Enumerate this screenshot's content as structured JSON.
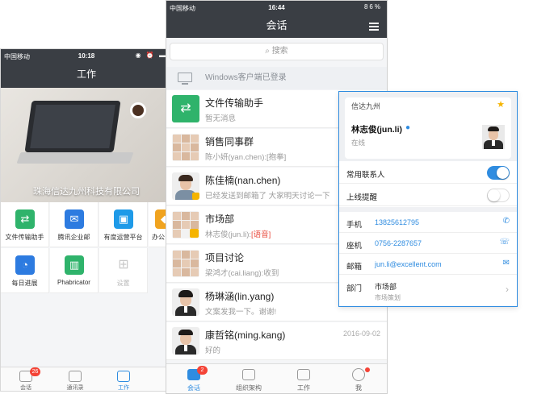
{
  "left_phone": {
    "status": {
      "carrier": "中国移动",
      "time": "10:18"
    },
    "title": "工作",
    "hero_caption": "珠海信达九州科技有限公司",
    "apps": [
      {
        "label": "文件传输助手",
        "icon": "file-transfer-icon",
        "color": "#2fb36b"
      },
      {
        "label": "腾讯企业邮",
        "icon": "mail-icon",
        "color": "#2d7be0"
      },
      {
        "label": "有度运营平台",
        "icon": "briefcase-icon",
        "color": "#1e9ae8"
      },
      {
        "label": "办公",
        "icon": "office-icon",
        "color": "#f0a31f"
      },
      {
        "label": "每日进展",
        "icon": "daily-progress-icon",
        "color": "#2d7be0"
      },
      {
        "label": "Phabricator",
        "icon": "chart-icon",
        "color": "#2fb36b"
      },
      {
        "label": "设置",
        "icon": "settings-icon",
        "color": "#c9c9c9"
      }
    ],
    "tabs": [
      {
        "label": "会话",
        "badge": "26"
      },
      {
        "label": "通讯录"
      },
      {
        "label": "工作"
      }
    ]
  },
  "center_phone": {
    "status": {
      "carrier": "中国移动",
      "time": "16:44",
      "battery": "86%"
    },
    "title": "会话",
    "search_placeholder": "搜索",
    "desktop_notice": "Windows客户端已登录",
    "conversations": [
      {
        "name": "文件传输助手",
        "preview": "暂无消息",
        "date": ""
      },
      {
        "name": "销售同事群",
        "preview": "陈小妍(yan.chen):[抱拳]",
        "date": ""
      },
      {
        "name": "陈佳楠(nan.chen)",
        "preview": "已经发送到邮箱了 大家明天讨论一下",
        "date": ""
      },
      {
        "name": "市场部",
        "preview_prefix": "林志俊(jun.li):",
        "preview_highlight": "[语音]",
        "date": ""
      },
      {
        "name": "项目讨论",
        "preview": "梁鸿才(cai.liang):收到",
        "date": ""
      },
      {
        "name": "杨琳涵(lin.yang)",
        "preview": "文案发我一下。谢谢!",
        "date": ""
      },
      {
        "name": "康哲铭(ming.kang)",
        "preview": "好的",
        "date": "2016-09-02"
      }
    ],
    "tabs": [
      {
        "label": "会话",
        "badge": "2"
      },
      {
        "label": "组织架构"
      },
      {
        "label": "工作"
      },
      {
        "label": "我"
      }
    ]
  },
  "contact_card": {
    "company": "信达九州",
    "name": "林志俊(jun.li)",
    "status": "在线",
    "frequent_contact": {
      "label": "常用联系人",
      "on": true
    },
    "online_alert": {
      "label": "上线提醒",
      "on": false
    },
    "phone": {
      "label": "手机",
      "value": "13825612795"
    },
    "landline": {
      "label": "座机",
      "value": "0756-2287657"
    },
    "email": {
      "label": "邮箱",
      "value": "jun.li@excellent.com"
    },
    "department": {
      "label": "部门",
      "value": "市场部",
      "sub": "市场策划"
    },
    "colors": {
      "accent": "#2f8ce0",
      "star": "#f5b400",
      "toggle_on": "#2f8ce0"
    }
  }
}
